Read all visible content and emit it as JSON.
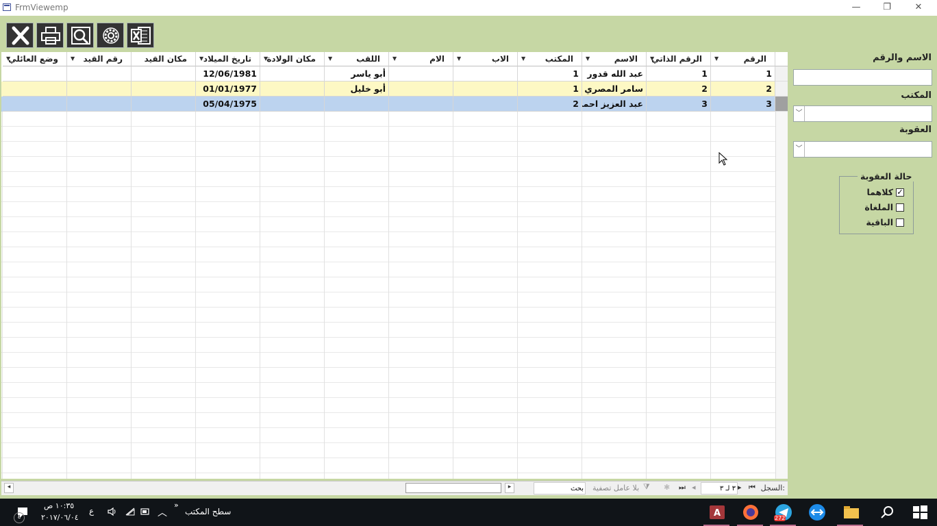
{
  "window": {
    "title": "FrmViewemp",
    "minimize": "—",
    "restore": "❐",
    "close": "✕"
  },
  "toolbar": {
    "buttons": [
      {
        "name": "close-form-button",
        "icon": "close-x-icon"
      },
      {
        "name": "print-button",
        "icon": "printer-icon"
      },
      {
        "name": "preview-button",
        "icon": "magnifier-icon"
      },
      {
        "name": "settings-button",
        "icon": "gear-icon"
      },
      {
        "name": "export-excel-button",
        "icon": "excel-icon"
      }
    ]
  },
  "grid": {
    "columns": [
      {
        "label": "الرقم",
        "dropdown": true
      },
      {
        "label": "الرقم الذاتي",
        "dropdown": true
      },
      {
        "label": "الاسم",
        "dropdown": true
      },
      {
        "label": "المكتب",
        "dropdown": true
      },
      {
        "label": "الاب",
        "dropdown": true
      },
      {
        "label": "الام",
        "dropdown": true
      },
      {
        "label": "اللقب",
        "dropdown": true
      },
      {
        "label": "مكان الولادة",
        "dropdown": true
      },
      {
        "label": "تاريخ الميلاد",
        "dropdown": true
      },
      {
        "label": "مكان القيد",
        "dropdown": false
      },
      {
        "label": "رقم القيد",
        "dropdown": true
      },
      {
        "label": "وضع العائلي",
        "dropdown": true
      }
    ],
    "rows": [
      {
        "cells": [
          "1",
          "1",
          "عبد الله قدور",
          "1",
          "",
          "",
          "أبو ياسر",
          "",
          "12/06/1981",
          "",
          "",
          ""
        ],
        "state": "normal"
      },
      {
        "cells": [
          "2",
          "2",
          "سامر المصري",
          "1",
          "",
          "",
          "أبو خليل",
          "",
          "01/01/1977",
          "",
          "",
          ""
        ],
        "state": "alternate"
      },
      {
        "cells": [
          "3",
          "3",
          "عبد العزيز احمد",
          "2",
          "",
          "",
          "",
          "",
          "05/04/1975",
          "",
          "",
          ""
        ],
        "state": "selected"
      }
    ],
    "row_colors": {
      "normal": "#ffffff",
      "alternate": "#fdf8c4",
      "selected": "#bcd3ef"
    }
  },
  "navbar": {
    "record_label": "السجل:",
    "record_value": "٣ لـ ٣",
    "filter_label": "بلا عامل تصفية",
    "search_placeholder": "بحث"
  },
  "filters": {
    "name_number_label": "الاسم والرقم",
    "name_number_value": "",
    "office_label": "المكتب",
    "office_value": "",
    "membership_label": "العقوبة",
    "membership_value": "",
    "status_group_label": "حالة العقوبة",
    "status_options": [
      {
        "label": "كلاهما",
        "checked": true
      },
      {
        "label": "الملغاة",
        "checked": false
      },
      {
        "label": "الباقية",
        "checked": false
      }
    ]
  },
  "taskbar": {
    "time": "١٠:٣٥ ص",
    "date": "٢٠١٧/٠٦/٠٤",
    "lang": "ع",
    "desktop_label": "سطح المكتب",
    "telegram_badge": "272"
  }
}
